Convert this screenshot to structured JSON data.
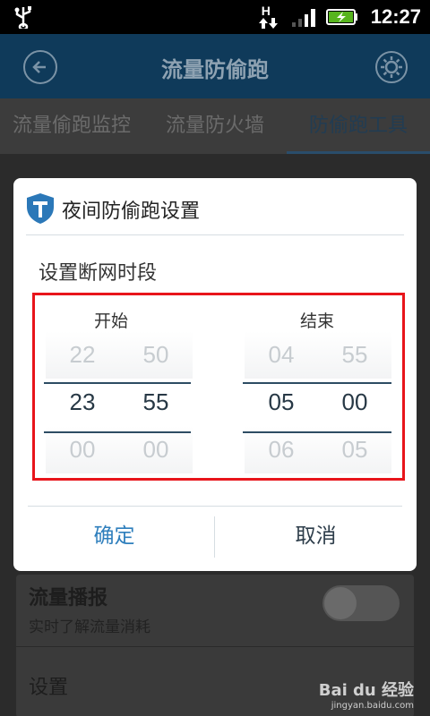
{
  "status_bar": {
    "time": "12:27",
    "network_letter": "H"
  },
  "app": {
    "title": "流量防偷跑",
    "tabs": [
      {
        "label": "流量偷跑监控"
      },
      {
        "label": "流量防火墙"
      },
      {
        "label": "防偷跑工具"
      }
    ],
    "card": {
      "row1_title": "流量播报",
      "row1_subtitle": "实时了解流量消耗",
      "row2_title": "设置"
    },
    "watermark": {
      "brand": "Bai du 经验",
      "url": "jingyan.baidu.com"
    }
  },
  "dialog": {
    "title": "夜间防偷跑设置",
    "section_label": "设置断网时段",
    "start": {
      "label": "开始",
      "hour": {
        "prev": "22",
        "current": "23",
        "next": "00"
      },
      "minute": {
        "prev": "50",
        "current": "55",
        "next": "00"
      }
    },
    "end": {
      "label": "结束",
      "hour": {
        "prev": "04",
        "current": "05",
        "next": "06"
      },
      "minute": {
        "prev": "55",
        "current": "00",
        "next": "05"
      }
    },
    "confirm_label": "确定",
    "cancel_label": "取消"
  },
  "colors": {
    "highlight_border": "#e8151b",
    "confirm_text": "#2f7fbd"
  }
}
